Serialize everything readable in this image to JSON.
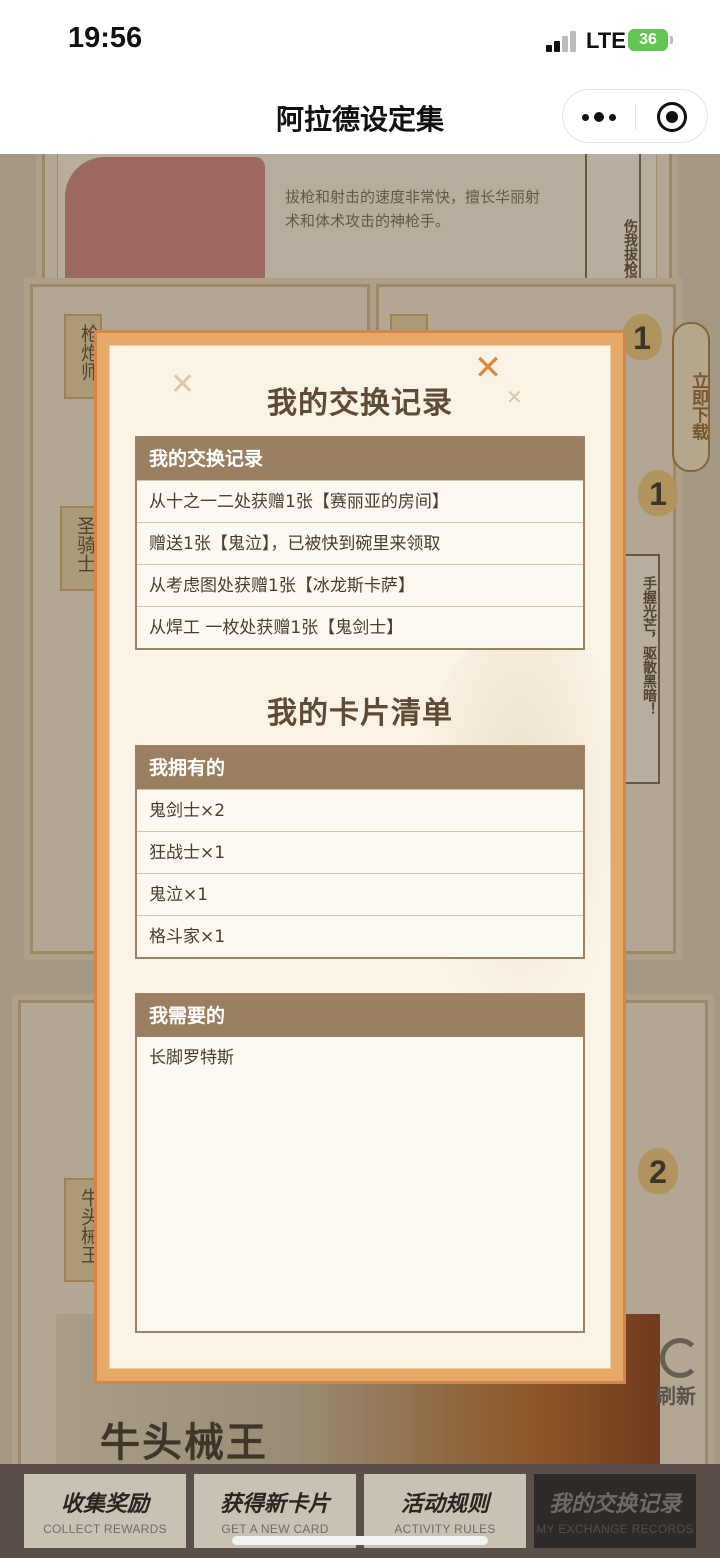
{
  "status_bar": {
    "time": "19:56",
    "network": "LTE",
    "battery": "36"
  },
  "nav": {
    "title": "阿拉德设定集"
  },
  "background": {
    "card1_text": "拔枪和射击的速度非常快，擅长华丽射术和体术攻击的神枪手。",
    "side_banner_text": "伤我拔枪得速度！",
    "side_banner2_text": "手握光芒，驱散黑暗！",
    "download_label": "立即下载",
    "tags": [
      "枪炮师",
      "圣",
      "圣骑士",
      "牛头械王"
    ],
    "badges": [
      "1",
      "1",
      "2"
    ],
    "refresh_label": "刷新",
    "boss_title": "牛头械王"
  },
  "tabs": [
    {
      "cn": "收集奖励",
      "en": "COLLECT REWARDS"
    },
    {
      "cn": "获得新卡片",
      "en": "GET A NEW CARD"
    },
    {
      "cn": "活动规则",
      "en": "ACTIVITY RULES"
    },
    {
      "cn": "我的交换记录",
      "en": "MY EXCHANGE RECORDS"
    }
  ],
  "modal": {
    "close_glyph": "✕",
    "records_title": "我的交换记录",
    "records_table": {
      "header": "我的交换记录",
      "rows": [
        "从十之一二处获赠1张【赛丽亚的房间】",
        "赠送1张【鬼泣】，已被快到碗里来领取",
        "从考虑图处获赠1张【冰龙斯卡萨】",
        "从焊工 一枚处获赠1张【鬼剑士】"
      ]
    },
    "cards_title": "我的卡片清单",
    "owned_table": {
      "header": "我拥有的",
      "rows": [
        "鬼剑士×2",
        "狂战士×1",
        "鬼泣×1",
        "格斗家×1"
      ]
    },
    "needed_table": {
      "header": "我需要的",
      "rows": [
        "长脚罗特斯"
      ]
    }
  }
}
